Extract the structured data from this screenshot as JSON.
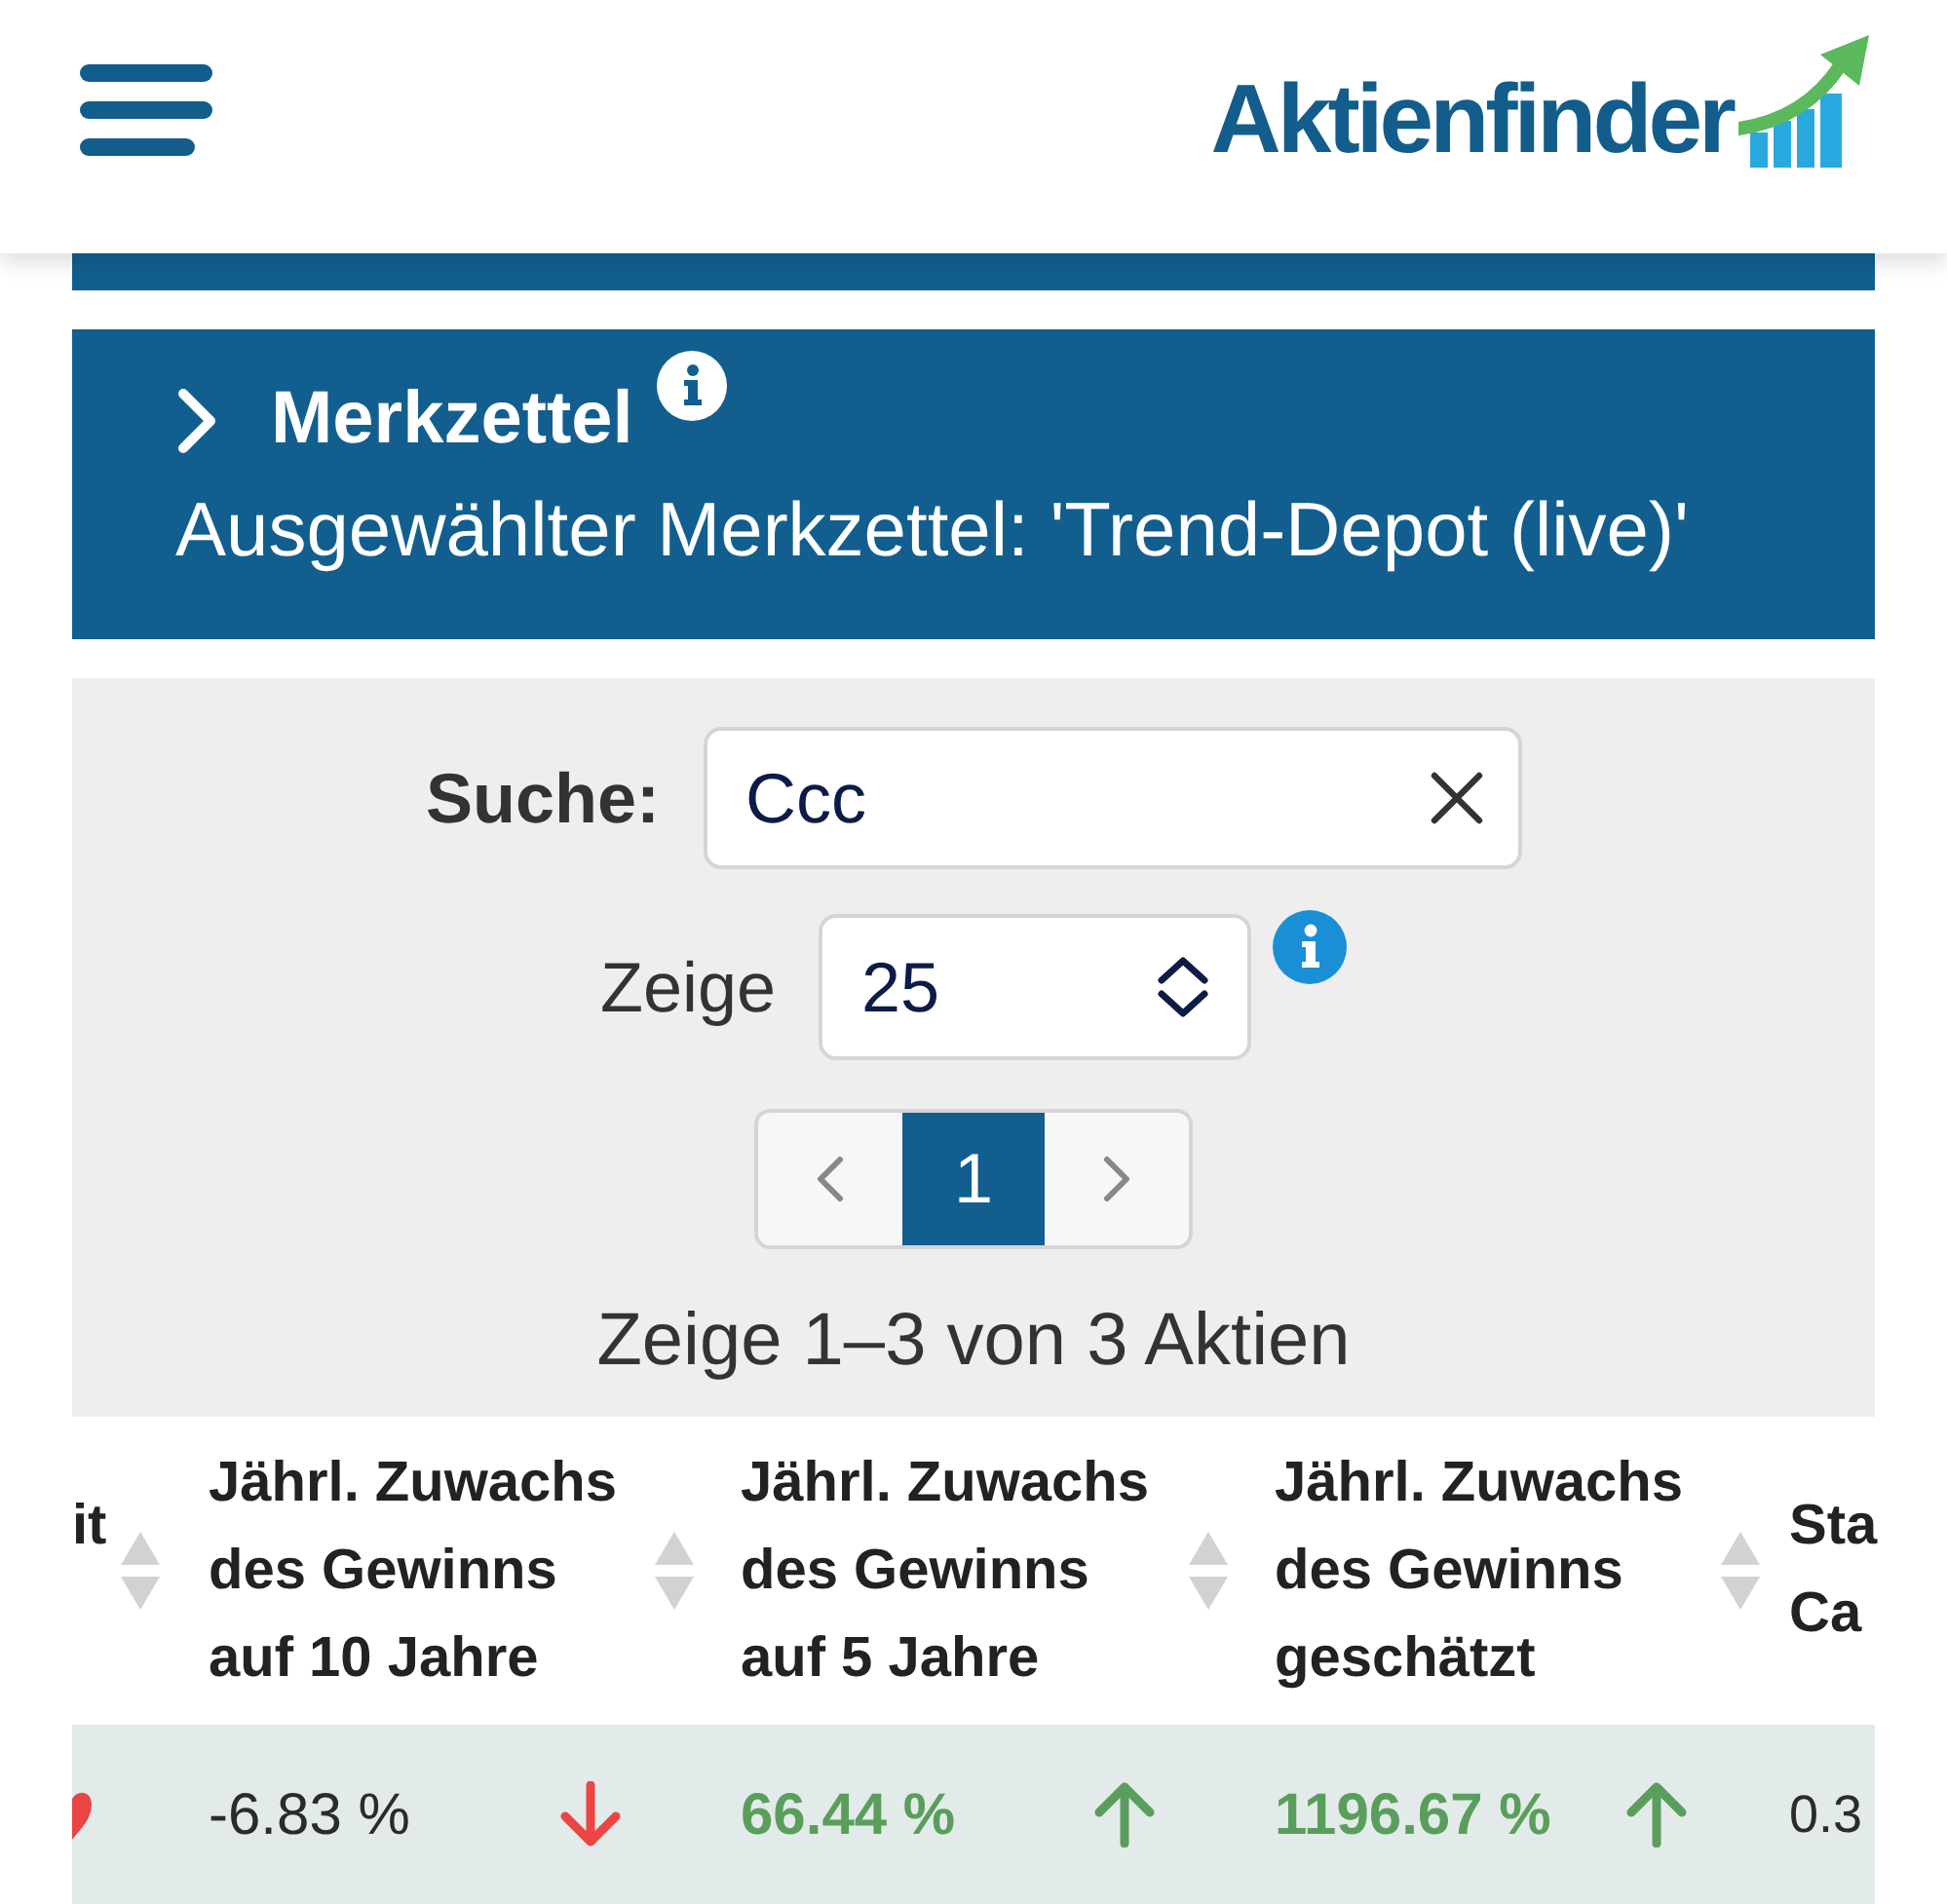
{
  "header": {
    "logo": "Aktienfinder"
  },
  "watchlist": {
    "title": "Merkzettel",
    "expanded": false,
    "subtitle": "Ausgewählter Merkzettel: 'Trend-Depot (live)'"
  },
  "filters": {
    "search": {
      "label": "Suche:",
      "value": "Ccc"
    },
    "page_size": {
      "label": "Zeige",
      "value": "25"
    },
    "pagination": [
      {
        "label": "1",
        "selected": true
      }
    ],
    "summary": "Zeige 1–3 von 3 Aktien"
  },
  "table": {
    "columns": [
      {
        "lines": [
          "it"
        ],
        "sortable": true
      },
      {
        "lines": [
          "Jährl. Zuwachs",
          "des Gewinns",
          "auf 10 Jahre"
        ],
        "sortable": true
      },
      {
        "lines": [
          "Jährl. Zuwachs",
          "des Gewinns",
          "auf 5 Jahre"
        ],
        "sortable": true
      },
      {
        "lines": [
          "Jährl. Zuwachs",
          "des Gewinns",
          "geschätzt"
        ],
        "sortable": true
      },
      {
        "lines": [
          "Sta",
          "Ca"
        ],
        "sortable": false
      }
    ],
    "rows": [
      {
        "cells": [
          {
            "kind": "marker"
          },
          {
            "kind": "change",
            "text": "-6.83 %",
            "rising": false
          },
          {
            "kind": "change",
            "text": "66.44 %",
            "rising": true
          },
          {
            "kind": "change",
            "text": "1196.67 %",
            "rising": true
          },
          {
            "kind": "plain",
            "text": "0.3"
          }
        ]
      }
    ]
  }
}
